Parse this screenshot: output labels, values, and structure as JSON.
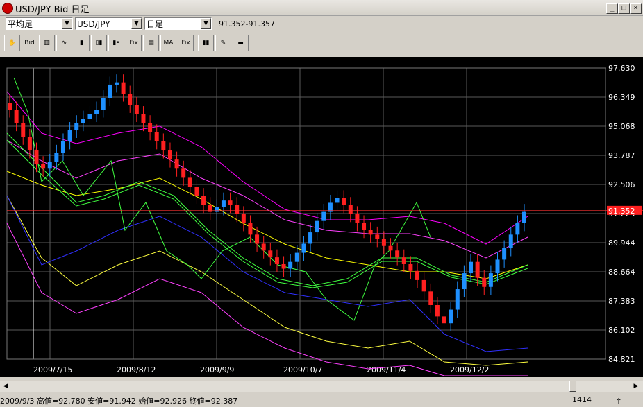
{
  "window": {
    "title": "USD/JPY Bid 日足"
  },
  "controls": {
    "mode": "平均足",
    "pair": "USD/JPY",
    "period": "日足",
    "range": "91.352-91.357"
  },
  "toolbar": {
    "buttons": [
      {
        "icon": "hand-icon",
        "glyph": "✋"
      },
      {
        "icon": "bid-ask-icon",
        "glyph": "Bid"
      },
      {
        "icon": "bar-chart-icon",
        "glyph": "▥"
      },
      {
        "icon": "wave-icon",
        "glyph": "∿"
      },
      {
        "icon": "candle-red-icon",
        "glyph": "▮"
      },
      {
        "icon": "candle-pair-icon",
        "glyph": "▯▮"
      },
      {
        "icon": "candle-dots-icon",
        "glyph": "▮•"
      },
      {
        "icon": "fix-icon",
        "glyph": "Fix"
      },
      {
        "icon": "chart-gray-icon",
        "glyph": "▤"
      },
      {
        "icon": "ma-fix-icon",
        "glyph": "MA"
      },
      {
        "icon": "fix-table-icon",
        "glyph": "Fix"
      },
      {
        "icon": "candle-color-icon",
        "glyph": "▮▮"
      },
      {
        "icon": "pencil-icon",
        "glyph": "✎"
      },
      {
        "icon": "printer-icon",
        "glyph": "▬"
      }
    ]
  },
  "chart_data": {
    "type": "candlestick",
    "y_ticks": [
      "97.630",
      "96.349",
      "95.068",
      "93.787",
      "92.506",
      "91.225",
      "89.944",
      "88.664",
      "87.383",
      "86.102",
      "84.821"
    ],
    "ylim": [
      84.821,
      97.63
    ],
    "x_ticks": [
      "2009/7/15",
      "2009/8/12",
      "2009/9/9",
      "2009/10/7",
      "2009/11/4",
      "2009/12/2"
    ],
    "current_price_label": "91.352",
    "current_price": 91.352,
    "colors": {
      "up": "#1e90ff",
      "down": "#ff2020",
      "grid": "#5a5a5a",
      "price_line": "#ff3030"
    }
  },
  "status": {
    "text": "2009/9/3  高値=92.780 安値=91.942 始値=92.926 終値=92.387",
    "count": "1414"
  }
}
